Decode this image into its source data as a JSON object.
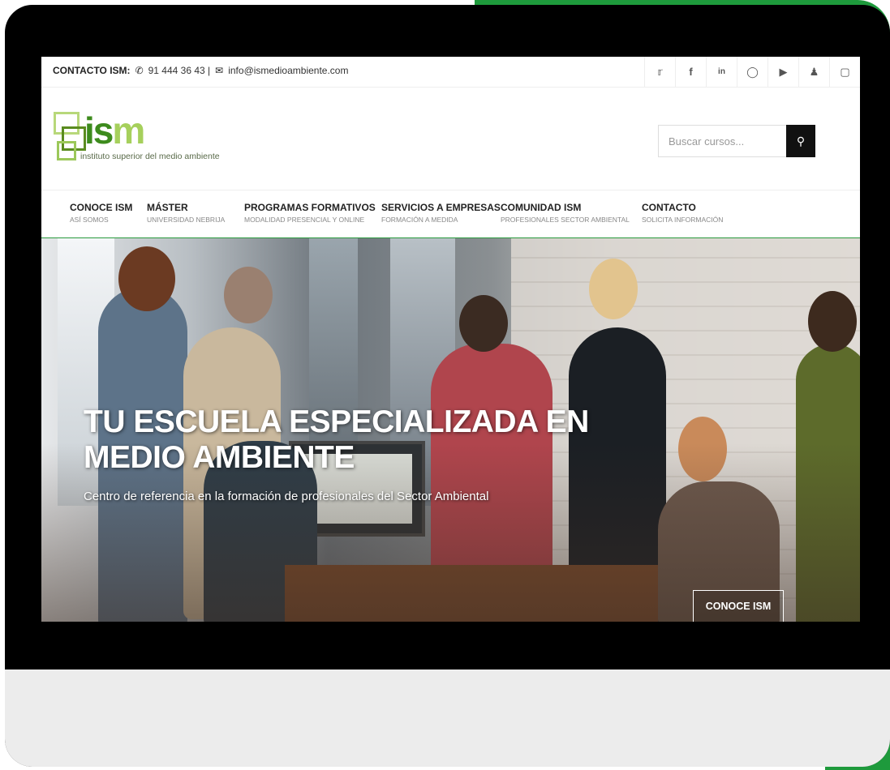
{
  "topbar": {
    "contact_label": "CONTACTO ISM:",
    "phone": "91 444 36 43 |",
    "email": "info@ismedioambiente.com",
    "social_icons": [
      "twitter-icon",
      "facebook-icon",
      "linkedin-icon",
      "instagram-icon",
      "youtube-icon",
      "community-icon",
      "campus-icon"
    ]
  },
  "logo": {
    "brand_a": "is",
    "brand_b": "m",
    "tagline": "instituto superior del medio ambiente"
  },
  "search": {
    "placeholder": "Buscar cursos..."
  },
  "nav": [
    {
      "title": "CONOCE ISM",
      "subtitle": "ASÍ SOMOS"
    },
    {
      "title": "MÁSTER",
      "subtitle": "UNIVERSIDAD NEBRIJA"
    },
    {
      "title": "PROGRAMAS FORMATIVOS",
      "subtitle": "MODALIDAD PRESENCIAL Y ONLINE"
    },
    {
      "title": "SERVICIOS A EMPRESAS",
      "subtitle": "FORMACIÓN A MEDIDA"
    },
    {
      "title": "COMUNIDAD ISM",
      "subtitle": "PROFESIONALES SECTOR AMBIENTAL"
    },
    {
      "title": "CONTACTO",
      "subtitle": "SOLICITA INFORMACIÓN"
    }
  ],
  "hero": {
    "headline": "TU ESCUELA ESPECIALIZADA EN MEDIO AMBIENTE",
    "subheadline": "Centro de referencia en la formación de profesionales del Sector Ambiental",
    "cta_label": "CONOCE ISM"
  },
  "colors": {
    "accent_green": "#2a9a3e",
    "frame": "#000000"
  }
}
